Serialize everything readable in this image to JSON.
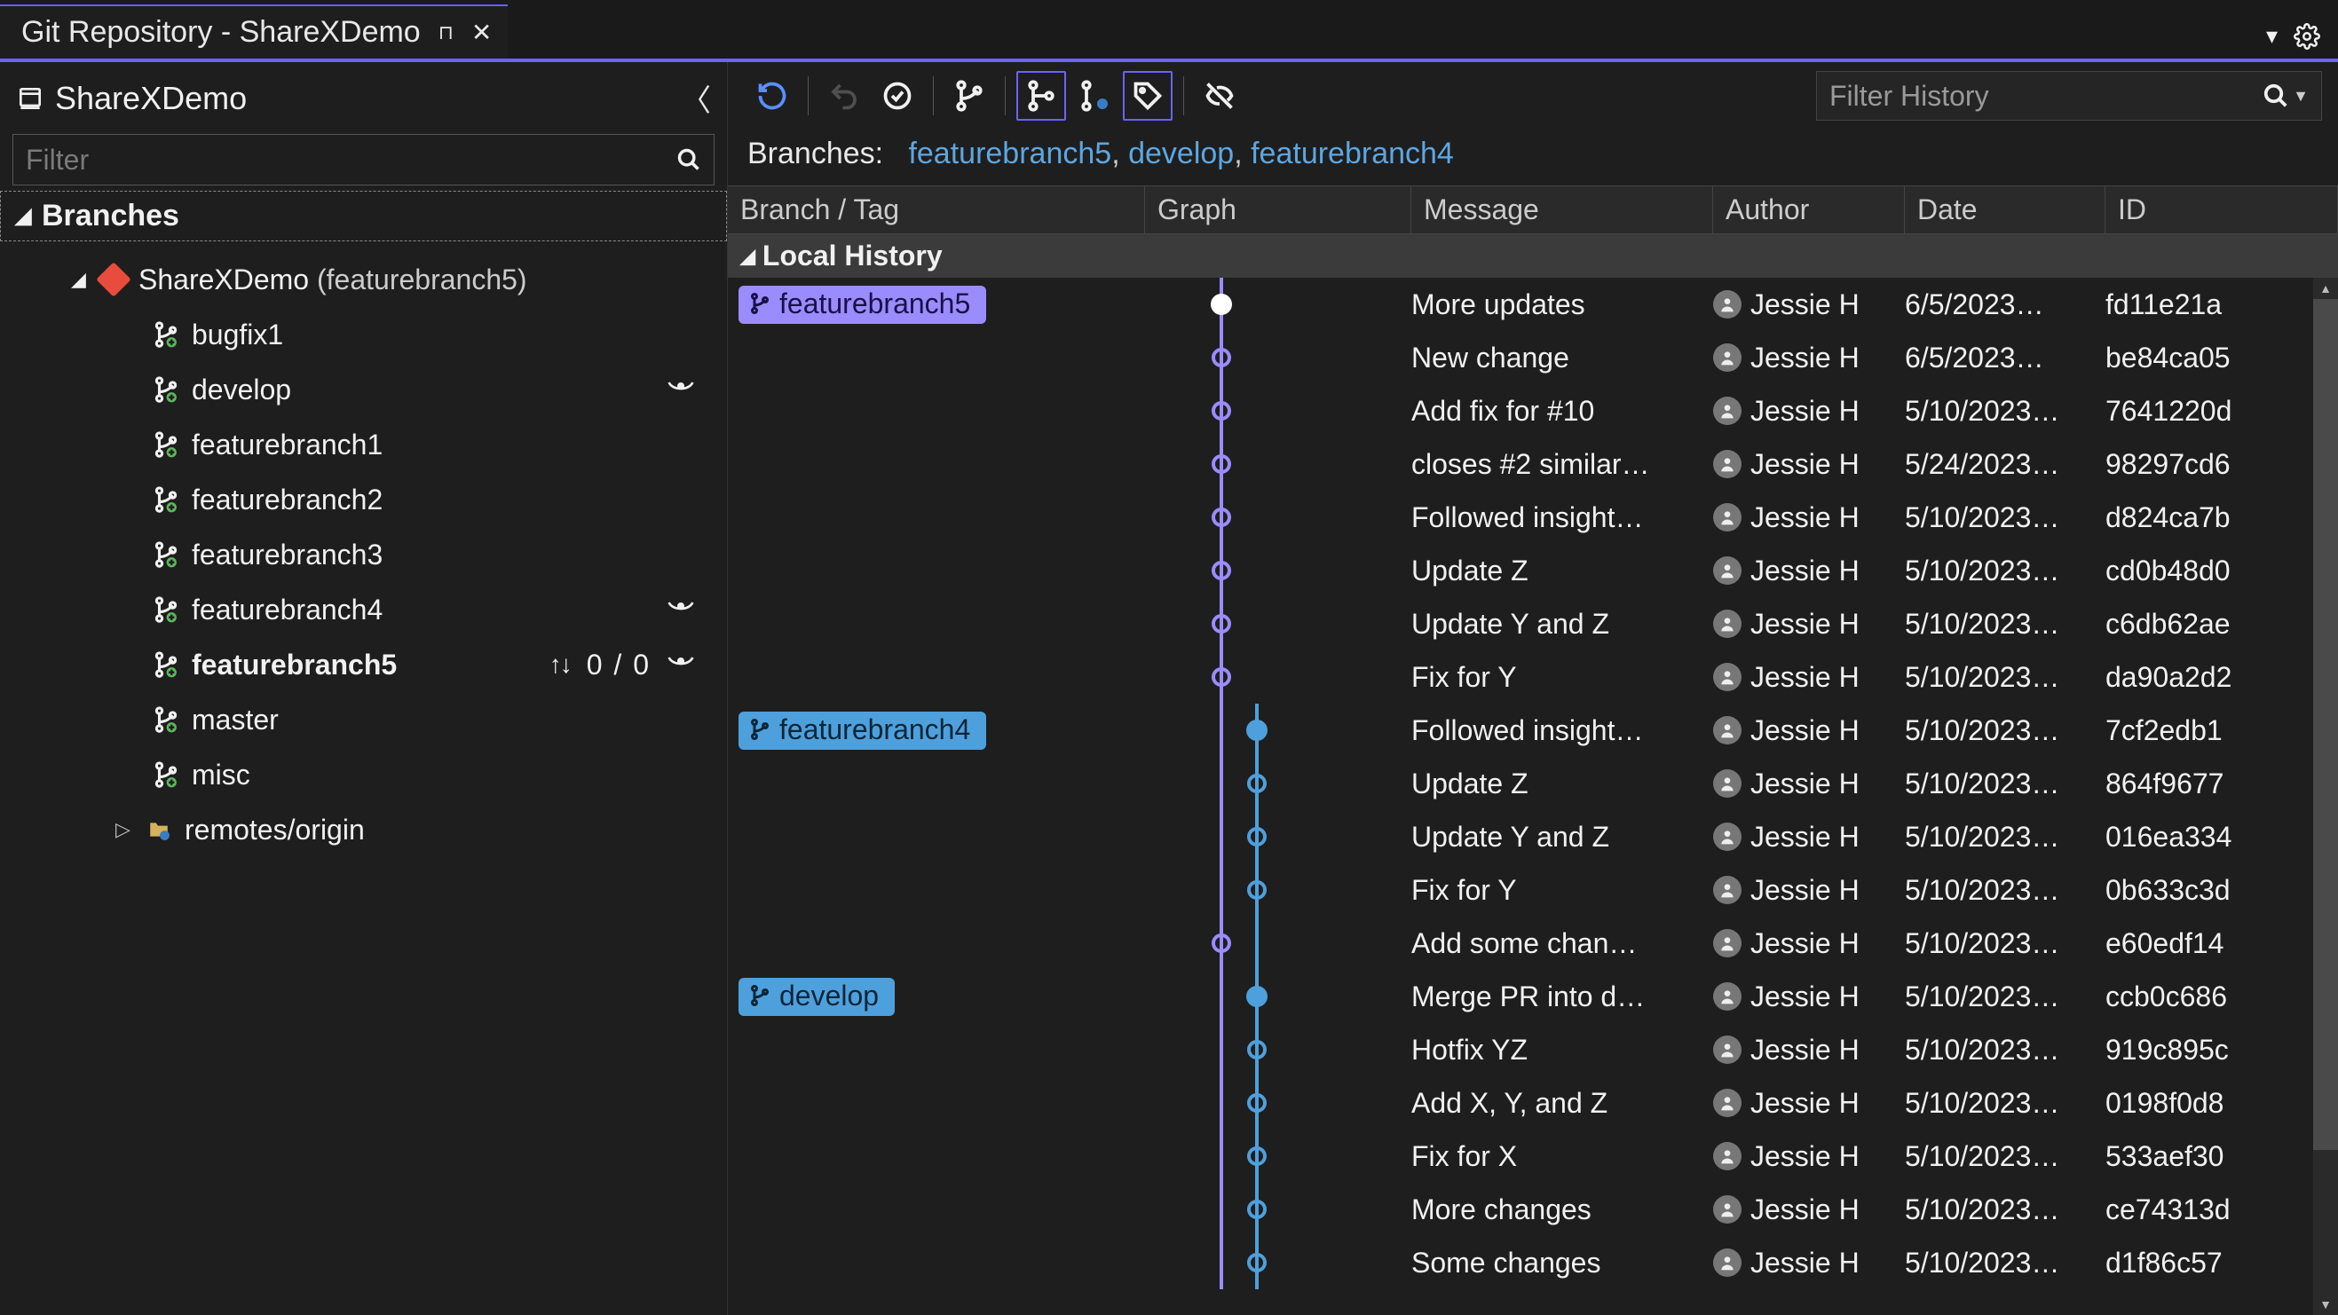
{
  "window": {
    "tab_title": "Git Repository - ShareXDemo"
  },
  "sidebar": {
    "repo_title": "ShareXDemo",
    "filter_placeholder": "Filter",
    "section_label": "Branches",
    "repo_node": {
      "name": "ShareXDemo",
      "suffix": "(featurebranch5)"
    },
    "branches": [
      {
        "name": "bugfix1",
        "eye": false,
        "bold": false,
        "sync": null
      },
      {
        "name": "develop",
        "eye": true,
        "bold": false,
        "sync": null
      },
      {
        "name": "featurebranch1",
        "eye": false,
        "bold": false,
        "sync": null
      },
      {
        "name": "featurebranch2",
        "eye": false,
        "bold": false,
        "sync": null
      },
      {
        "name": "featurebranch3",
        "eye": false,
        "bold": false,
        "sync": null
      },
      {
        "name": "featurebranch4",
        "eye": true,
        "bold": false,
        "sync": null
      },
      {
        "name": "featurebranch5",
        "eye": true,
        "bold": true,
        "sync": "0 / 0"
      },
      {
        "name": "master",
        "eye": false,
        "bold": false,
        "sync": null
      },
      {
        "name": "misc",
        "eye": false,
        "bold": false,
        "sync": null
      }
    ],
    "remote_label": "remotes/origin"
  },
  "main": {
    "branches_label": "Branches:",
    "branch_links": [
      "featurebranch5",
      "develop",
      "featurebranch4"
    ],
    "filter_history_placeholder": "Filter History",
    "columns": {
      "branch": "Branch / Tag",
      "graph": "Graph",
      "msg": "Message",
      "author": "Author",
      "date": "Date",
      "id": "ID"
    },
    "subheader": "Local History",
    "commits": [
      {
        "pill": {
          "text": "featurebranch5",
          "color": "purple"
        },
        "lane": 0,
        "node": "head",
        "msg": "More updates",
        "author": "Jessie H",
        "date": "6/5/2023…",
        "id": "fd11e21a"
      },
      {
        "pill": null,
        "lane": 0,
        "node": "open",
        "msg": "New change",
        "author": "Jessie H",
        "date": "6/5/2023…",
        "id": "be84ca05"
      },
      {
        "pill": null,
        "lane": 0,
        "node": "open",
        "msg": "Add fix for #10",
        "author": "Jessie H",
        "date": "5/10/2023…",
        "id": "7641220d"
      },
      {
        "pill": null,
        "lane": 0,
        "node": "open",
        "msg": "closes #2 similar…",
        "author": "Jessie H",
        "date": "5/24/2023…",
        "id": "98297cd6"
      },
      {
        "pill": null,
        "lane": 0,
        "node": "open",
        "msg": "Followed insight…",
        "author": "Jessie H",
        "date": "5/10/2023…",
        "id": "d824ca7b"
      },
      {
        "pill": null,
        "lane": 0,
        "node": "open",
        "msg": "Update Z",
        "author": "Jessie H",
        "date": "5/10/2023…",
        "id": "cd0b48d0"
      },
      {
        "pill": null,
        "lane": 0,
        "node": "open",
        "msg": "Update Y and Z",
        "author": "Jessie H",
        "date": "5/10/2023…",
        "id": "c6db62ae"
      },
      {
        "pill": null,
        "lane": 0,
        "node": "open",
        "msg": "Fix for Y",
        "author": "Jessie H",
        "date": "5/10/2023…",
        "id": "da90a2d2"
      },
      {
        "pill": {
          "text": "featurebranch4",
          "color": "blue"
        },
        "lane": 1,
        "node": "solidb",
        "msg": "Followed insight…",
        "author": "Jessie H",
        "date": "5/10/2023…",
        "id": "7cf2edb1"
      },
      {
        "pill": null,
        "lane": 1,
        "node": "openb",
        "msg": "Update Z",
        "author": "Jessie H",
        "date": "5/10/2023…",
        "id": "864f9677"
      },
      {
        "pill": null,
        "lane": 1,
        "node": "openb",
        "msg": "Update Y and Z",
        "author": "Jessie H",
        "date": "5/10/2023…",
        "id": "016ea334"
      },
      {
        "pill": null,
        "lane": 1,
        "node": "openb",
        "msg": "Fix for Y",
        "author": "Jessie H",
        "date": "5/10/2023…",
        "id": "0b633c3d"
      },
      {
        "pill": null,
        "lane": 0,
        "node": "open",
        "msg": "Add some chan…",
        "author": "Jessie H",
        "date": "5/10/2023…",
        "id": "e60edf14"
      },
      {
        "pill": {
          "text": "develop",
          "color": "blue"
        },
        "lane": 1,
        "node": "solidb",
        "msg": "Merge PR into d…",
        "author": "Jessie H",
        "date": "5/10/2023…",
        "id": "ccb0c686"
      },
      {
        "pill": null,
        "lane": 1,
        "node": "openb",
        "msg": "Hotfix YZ",
        "author": "Jessie H",
        "date": "5/10/2023…",
        "id": "919c895c"
      },
      {
        "pill": null,
        "lane": 1,
        "node": "openb",
        "msg": "Add X, Y, and Z",
        "author": "Jessie H",
        "date": "5/10/2023…",
        "id": "0198f0d8"
      },
      {
        "pill": null,
        "lane": 1,
        "node": "openb",
        "msg": "Fix for X",
        "author": "Jessie H",
        "date": "5/10/2023…",
        "id": "533aef30"
      },
      {
        "pill": null,
        "lane": 1,
        "node": "openb",
        "msg": "More changes",
        "author": "Jessie H",
        "date": "5/10/2023…",
        "id": "ce74313d"
      },
      {
        "pill": null,
        "lane": 1,
        "node": "openb",
        "msg": "Some changes",
        "author": "Jessie H",
        "date": "5/10/2023…",
        "id": "d1f86c57"
      }
    ]
  }
}
